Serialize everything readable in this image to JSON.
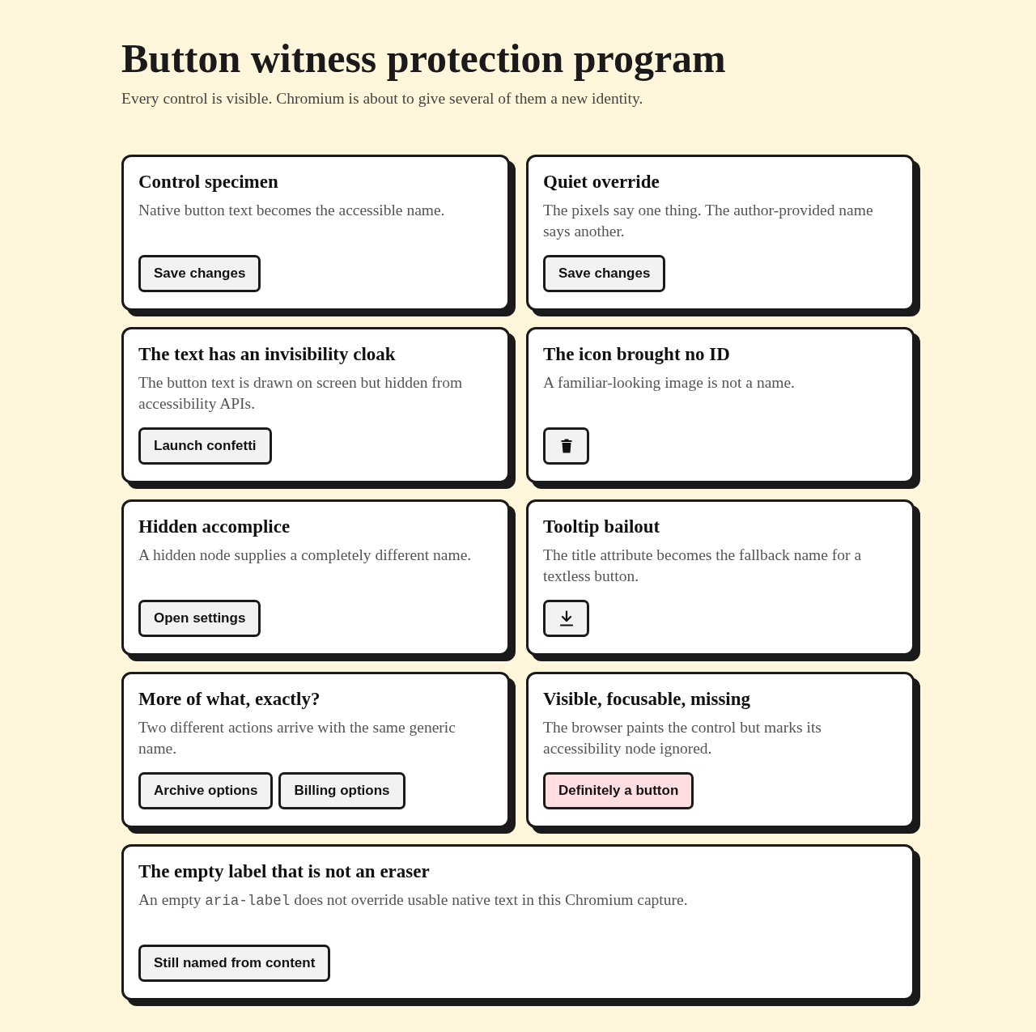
{
  "header": {
    "title": "Button witness protection program",
    "subtitle": "Every control is visible. Chromium is about to give several of them a new identity."
  },
  "cards": [
    {
      "title": "Control specimen",
      "wide": false,
      "description": "Native button text becomes the accessible name.",
      "buttons": [
        {
          "kind": "text",
          "label": "Save changes",
          "color": "#f2f2f2"
        }
      ]
    },
    {
      "title": "Quiet override",
      "wide": false,
      "description": "The pixels say one thing. The author-provided name says another.",
      "buttons": [
        {
          "kind": "text",
          "label": "Save changes",
          "color": "#f2f2f2"
        }
      ]
    },
    {
      "title": "The text has an invisibility cloak",
      "wide": false,
      "description": "The button text is drawn on screen but hidden from accessibility APIs.",
      "buttons": [
        {
          "kind": "text",
          "label": "Launch confetti",
          "color": "#f2f2f2"
        }
      ]
    },
    {
      "title": "The icon brought no ID",
      "wide": false,
      "description": "A familiar-looking image is not a name.",
      "buttons": [
        {
          "kind": "trash",
          "color": "#f2f2f2"
        }
      ]
    },
    {
      "title": "Hidden accomplice",
      "wide": false,
      "description": "A hidden node supplies a completely different name.",
      "buttons": [
        {
          "kind": "text",
          "label": "Open settings",
          "color": "#f2f2f2"
        }
      ]
    },
    {
      "title": "Tooltip bailout",
      "wide": false,
      "description": "The title attribute becomes the fallback name for a textless button.",
      "buttons": [
        {
          "kind": "download",
          "color": "#f2f2f2"
        }
      ]
    },
    {
      "title": "More of what, exactly?",
      "wide": false,
      "description": "Two different actions arrive with the same generic name.",
      "buttons": [
        {
          "kind": "text",
          "label": "Archive options",
          "color": "#f2f2f2"
        },
        {
          "kind": "text",
          "label": "Billing options",
          "color": "#f2f2f2"
        }
      ]
    },
    {
      "title": "Visible, focusable, missing",
      "wide": false,
      "description": "The browser paints the control but marks its accessibility node ignored.",
      "buttons": [
        {
          "kind": "text",
          "label": "Definitely a button",
          "color": "#ffdde0"
        }
      ]
    },
    {
      "title": "The empty label that is not an eraser",
      "wide": true,
      "description_parts": [
        {
          "kind": "text",
          "text": "An empty "
        },
        {
          "kind": "code",
          "text": "aria-label"
        },
        {
          "kind": "text",
          "text": " does not override usable native text in this Chromium capture."
        }
      ],
      "buttons": [
        {
          "kind": "text",
          "label": "Still named from content",
          "color": "#f2f2f2"
        }
      ]
    }
  ]
}
